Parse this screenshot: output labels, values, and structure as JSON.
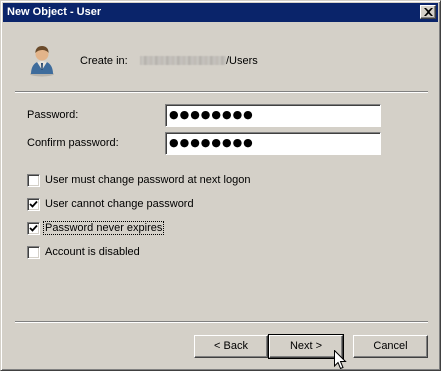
{
  "window": {
    "title": "New Object - User"
  },
  "header": {
    "create_in_label": "Create in:",
    "create_in_path_suffix": "/Users"
  },
  "fields": {
    "password_label": "Password:",
    "password_value": "●●●●●●●●",
    "confirm_label": "Confirm password:",
    "confirm_value": "●●●●●●●●"
  },
  "options": [
    {
      "label": "User must change password at next logon",
      "checked": false
    },
    {
      "label": "User cannot change password",
      "checked": true
    },
    {
      "label": "Password never expires",
      "checked": true,
      "focused": true
    },
    {
      "label": "Account is disabled",
      "checked": false
    }
  ],
  "buttons": {
    "back_label": "< Back",
    "next_label": "Next >",
    "cancel_label": "Cancel"
  },
  "colors": {
    "titlebar": "#0a246a",
    "face": "#d4d0c8"
  },
  "icons": {
    "user": "user-icon",
    "close": "close-icon",
    "check": "checkmark-icon",
    "cursor": "mouse-pointer-icon"
  }
}
